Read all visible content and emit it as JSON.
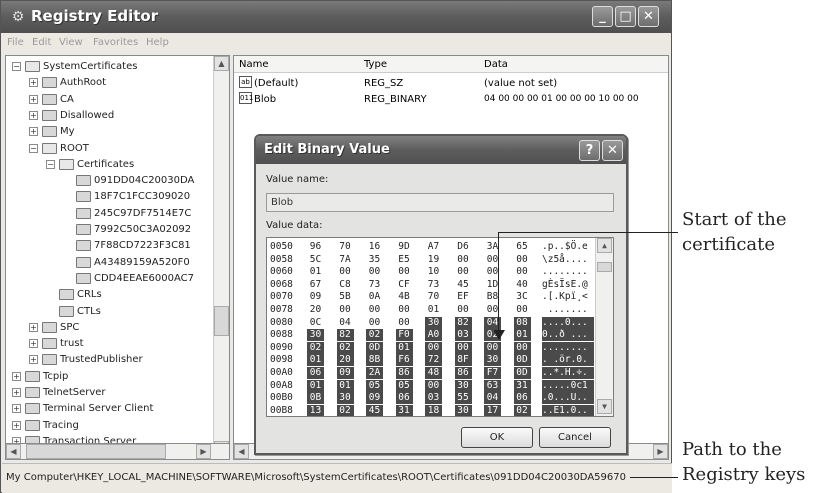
{
  "window": {
    "title": "Registry Editor",
    "menu": [
      "File",
      "Edit",
      "View",
      "Favorites",
      "Help"
    ],
    "buttons": {
      "minimize": "_",
      "maximize": "□",
      "close": "✕"
    }
  },
  "tree": {
    "items": [
      {
        "label": "SystemCertificates",
        "expander": "−"
      },
      {
        "label": "AuthRoot",
        "expander": "+"
      },
      {
        "label": "CA",
        "expander": "+"
      },
      {
        "label": "Disallowed",
        "expander": "+"
      },
      {
        "label": "My",
        "expander": "+"
      },
      {
        "label": "ROOT",
        "expander": "−"
      },
      {
        "label": "Certificates",
        "expander": "−"
      },
      {
        "label": "091DD04C20030DA",
        "expander": ""
      },
      {
        "label": "18F7C1FCC309020",
        "expander": ""
      },
      {
        "label": "245C97DF7514E7C",
        "expander": ""
      },
      {
        "label": "7992C50C3A02092",
        "expander": ""
      },
      {
        "label": "7F88CD7223F3C81",
        "expander": ""
      },
      {
        "label": "A43489159A520F0",
        "expander": ""
      },
      {
        "label": "CDD4EEAE6000AC7",
        "expander": ""
      },
      {
        "label": "CRLs",
        "expander": ""
      },
      {
        "label": "CTLs",
        "expander": ""
      },
      {
        "label": "SPC",
        "expander": "+"
      },
      {
        "label": "trust",
        "expander": "+"
      },
      {
        "label": "TrustedPublisher",
        "expander": "+"
      },
      {
        "label": "Tcpip",
        "expander": "+"
      },
      {
        "label": "TelnetServer",
        "expander": "+"
      },
      {
        "label": "Terminal Server Client",
        "expander": "+"
      },
      {
        "label": "Tracing",
        "expander": "+"
      },
      {
        "label": "Transaction Server",
        "expander": "+"
      }
    ]
  },
  "list": {
    "headers": {
      "name": "Name",
      "type": "Type",
      "data": "Data"
    },
    "rows": [
      {
        "icon": "ab",
        "name": "(Default)",
        "type": "REG_SZ",
        "data": "(value not set)"
      },
      {
        "icon": "011",
        "name": "Blob",
        "type": "REG_BINARY",
        "data": "04 00 00 00 01 00 00 00 10 00 00"
      }
    ]
  },
  "status": {
    "path": "My Computer\\HKEY_LOCAL_MACHINE\\SOFTWARE\\Microsoft\\SystemCertificates\\ROOT\\Certificates\\091DD04C20030DA59670"
  },
  "dialog": {
    "title": "Edit Binary Value",
    "help_button": "?",
    "close_button": "✕",
    "value_name_label": "Value name:",
    "value_name": "Blob",
    "value_data_label": "Value data:",
    "ok_label": "OK",
    "cancel_label": "Cancel",
    "hex_rows": [
      {
        "offset": "0050",
        "bytes": [
          "96",
          "70",
          "16",
          "9D",
          "A7",
          "D6",
          "3A",
          "65"
        ],
        "ascii": ".p..$Ö.e"
      },
      {
        "offset": "0058",
        "bytes": [
          "5C",
          "7A",
          "35",
          "E5",
          "19",
          "00",
          "00",
          "00"
        ],
        "ascii": "\\z5å...."
      },
      {
        "offset": "0060",
        "bytes": [
          "01",
          "00",
          "00",
          "00",
          "10",
          "00",
          "00",
          "00"
        ],
        "ascii": "........"
      },
      {
        "offset": "0068",
        "bytes": [
          "67",
          "C8",
          "73",
          "CF",
          "73",
          "45",
          "1D",
          "40"
        ],
        "ascii": "gÈsÏsE.@"
      },
      {
        "offset": "0070",
        "bytes": [
          "09",
          "5B",
          "0A",
          "4B",
          "70",
          "EF",
          "B8",
          "3C"
        ],
        "ascii": ".[.Kpï¸<"
      },
      {
        "offset": "0078",
        "bytes": [
          "20",
          "00",
          "00",
          "00",
          "01",
          "00",
          "00",
          "00"
        ],
        "ascii": " ......."
      },
      {
        "offset": "0080",
        "bytes": [
          "0C",
          "04",
          "00",
          "00",
          "30",
          "82",
          "04",
          "08"
        ],
        "ascii": "....0..."
      },
      {
        "offset": "0088",
        "bytes": [
          "30",
          "82",
          "02",
          "F0",
          "A0",
          "03",
          "02",
          "01"
        ],
        "ascii": "0..ð ..."
      },
      {
        "offset": "0090",
        "bytes": [
          "02",
          "02",
          "0D",
          "01",
          "00",
          "00",
          "00",
          "00"
        ],
        "ascii": "........"
      },
      {
        "offset": "0098",
        "bytes": [
          "01",
          "20",
          "8B",
          "F6",
          "72",
          "8F",
          "30",
          "0D"
        ],
        "ascii": ". .ör.0."
      },
      {
        "offset": "00A0",
        "bytes": [
          "06",
          "09",
          "2A",
          "86",
          "48",
          "86",
          "F7",
          "0D"
        ],
        "ascii": "..*.H.÷."
      },
      {
        "offset": "00A8",
        "bytes": [
          "01",
          "01",
          "05",
          "05",
          "00",
          "30",
          "63",
          "31"
        ],
        "ascii": ".....0c1"
      },
      {
        "offset": "00B0",
        "bytes": [
          "0B",
          "30",
          "09",
          "06",
          "03",
          "55",
          "04",
          "06"
        ],
        "ascii": ".0...U.."
      },
      {
        "offset": "00B8",
        "bytes": [
          "13",
          "02",
          "45",
          "31",
          "18",
          "30",
          "17",
          "02"
        ],
        "ascii": "..E1.0.."
      }
    ]
  },
  "annotations": {
    "start_line1": "Start of the",
    "start_line2": "certificate",
    "path_line1": "Path to the",
    "path_line2": "Registry keys"
  }
}
